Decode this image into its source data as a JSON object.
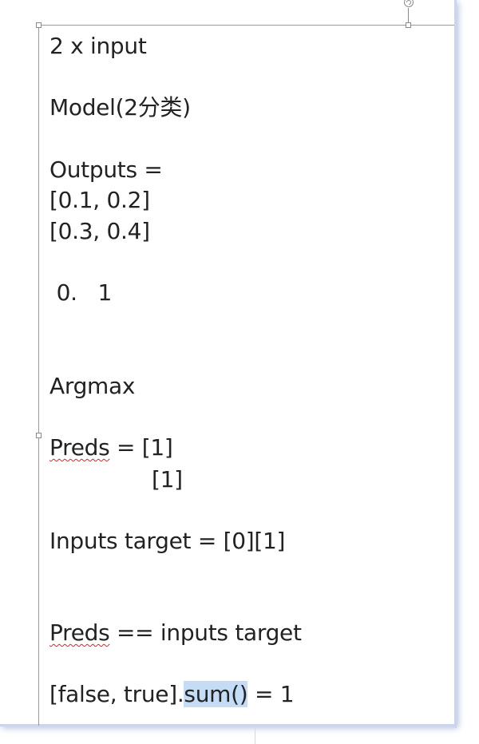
{
  "note": {
    "line1": "2 x input",
    "line2": "Model(2分类)",
    "line3": "Outputs =",
    "line4": "[0.1, 0.2]",
    "line5": "[0.3, 0.4]",
    "line6": " 0.   1",
    "line7": "Argmax",
    "line8_word": "Preds",
    "line8_rest": " = [1]",
    "line9": "[1]",
    "line10": "Inputs target = [0][1]",
    "line11_word": "Preds",
    "line11_rest": " == inputs target",
    "line12_prefix": "[false, true].",
    "line12_selected": "sum()",
    "line12_suffix": " = 1"
  },
  "colors": {
    "selection": "#c5dcf7",
    "spellcheck": "#e02020",
    "page_edge": "#c9d6f3"
  },
  "icons": {
    "rotate": "rotate-handle-icon"
  }
}
